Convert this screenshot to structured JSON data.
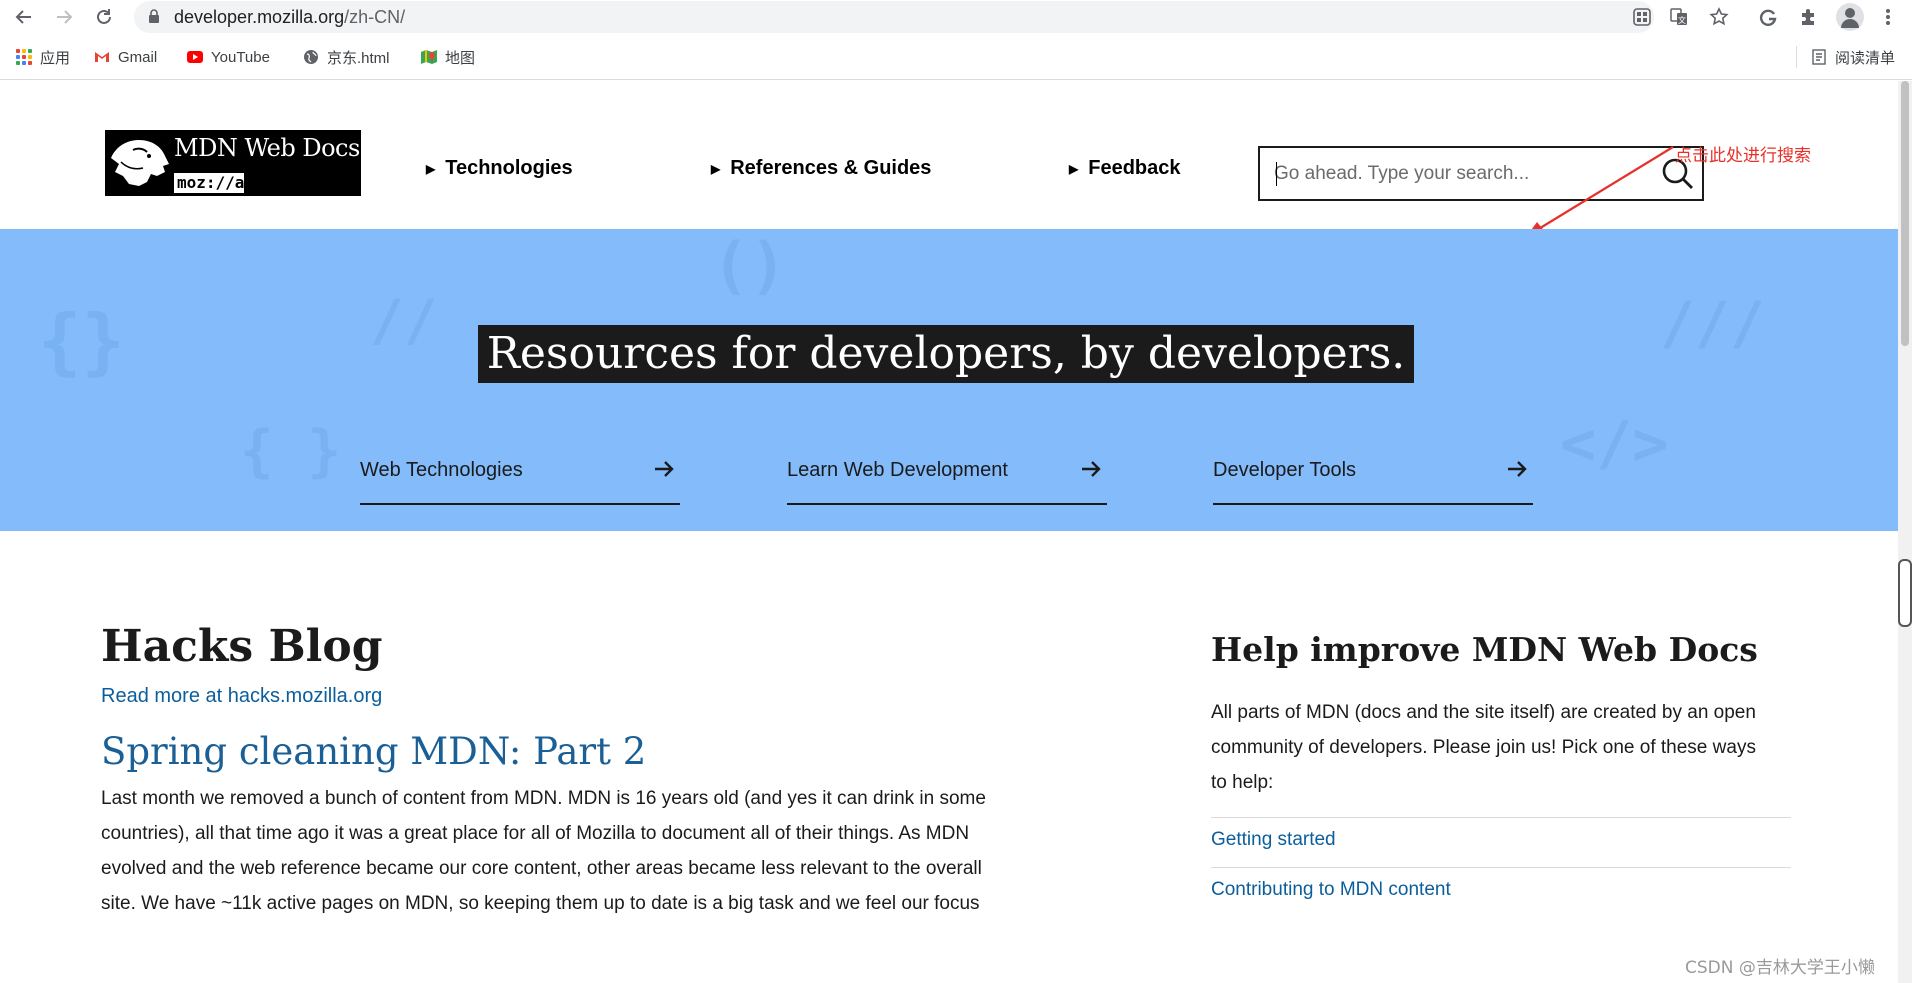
{
  "browser": {
    "url_host": "developer.mozilla.org",
    "url_path": "/zh-CN/",
    "bookmarks": [
      {
        "label": "应用",
        "icon": "apps-grid-icon"
      },
      {
        "label": "Gmail",
        "icon": "gmail-icon"
      },
      {
        "label": "YouTube",
        "icon": "youtube-icon"
      },
      {
        "label": "京东.html",
        "icon": "globe-icon"
      },
      {
        "label": "地图",
        "icon": "maps-icon"
      }
    ],
    "reading_list_label": "阅读清单"
  },
  "header": {
    "logo_text": "MDN Web Docs",
    "logo_sub": "moz://a",
    "nav": [
      {
        "label": "Technologies"
      },
      {
        "label": "References & Guides"
      },
      {
        "label": "Feedback"
      }
    ],
    "search_placeholder": "Go ahead. Type your search..."
  },
  "annotation": {
    "text": "点击此处进行搜索",
    "color": "#e8302a"
  },
  "hero": {
    "title": "Resources for developers, by developers.",
    "links": [
      {
        "label": "Web Technologies"
      },
      {
        "label": "Learn Web Development"
      },
      {
        "label": "Developer Tools"
      }
    ],
    "background": "#83bbfb"
  },
  "blog": {
    "title": "Hacks Blog",
    "read_more": "Read more at hacks.mozilla.org",
    "post_title": "Spring cleaning MDN: Part 2",
    "post_lines": [
      "Last month we removed a bunch of content from MDN. MDN is 16 years old (and yes it can drink in some",
      "countries), all that time ago it was a great place for all of Mozilla to document all of their things. As MDN",
      "evolved and the web reference became our core content, other areas became less relevant to the overall",
      "site. We have ~11k active pages on MDN, so keeping them up to date is a big task and we feel our focus"
    ]
  },
  "help": {
    "title": "Help improve MDN Web Docs",
    "body_lines": [
      "All parts of MDN (docs and the site itself) are created by an open",
      "community of developers. Please join us! Pick one of these ways",
      "to help:"
    ],
    "links": [
      {
        "label": "Getting started"
      },
      {
        "label": "Contributing to MDN content"
      }
    ]
  },
  "watermark": "CSDN @吉林大学王小懒"
}
